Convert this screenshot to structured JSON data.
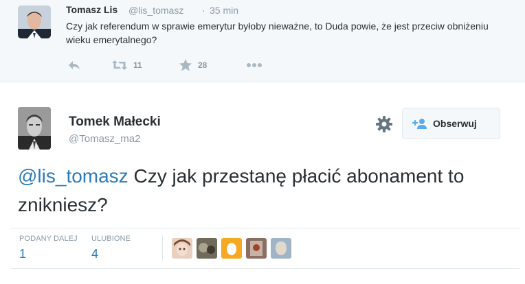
{
  "parent_tweet": {
    "name": "Tomasz Lis",
    "handle": "@lis_tomasz",
    "dot": "·",
    "time": "35 min",
    "text": "Czy jak referendum w sprawie emerytur byłoby nieważne, to Duda powie, że jest przeciw obniżeniu wieku emerytalnego?",
    "actions": {
      "reply_icon": "reply-icon",
      "retweet_icon": "retweet-icon",
      "retweet_count": "11",
      "favorite_icon": "star-icon",
      "favorite_count": "28",
      "more_icon": "more-dots-icon"
    }
  },
  "main_tweet": {
    "name": "Tomek Małecki",
    "handle": "@Tomasz_ma2",
    "mention": "@lis_tomasz",
    "text": " Czy jak przestanę płacić abonament to znikniesz?",
    "follow_label": "Obserwuj",
    "stats": {
      "retweets_label": "PODANY DALEJ",
      "retweets_value": "1",
      "favorites_label": "ULUBIONE",
      "favorites_value": "4"
    },
    "favoriters": [
      "avatar-1",
      "avatar-2",
      "avatar-3",
      "avatar-4",
      "avatar-5"
    ]
  },
  "colors": {
    "link": "#2b7bb9",
    "muted": "#8899a6",
    "icon": "#aab8c2",
    "border": "#e1e8ed",
    "parent_bg": "#f5f8fa"
  }
}
